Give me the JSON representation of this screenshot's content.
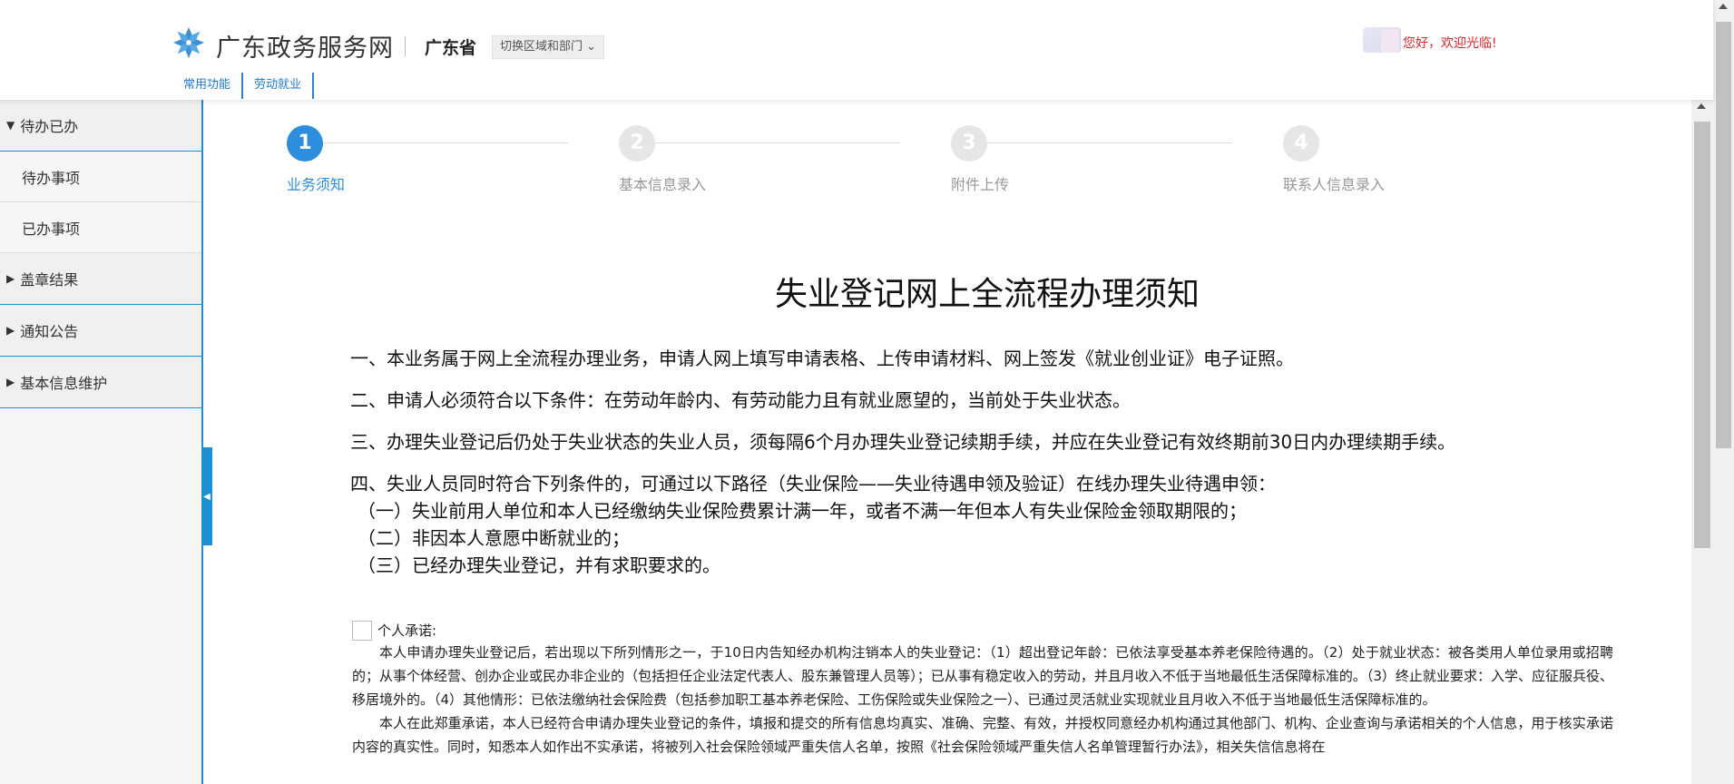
{
  "header": {
    "site_title": "广东政务服务网",
    "province": "广东省",
    "region_switch": "切换区域和部门 ⌄",
    "welcome": "您好，欢迎光临!",
    "nav_tabs": [
      "常用功能",
      "劳动就业"
    ]
  },
  "sidebar": {
    "groups": [
      {
        "label": "待办已办",
        "arrow": "▼",
        "items": [
          "待办事项",
          "已办事项"
        ]
      },
      {
        "label": "盖章结果",
        "arrow": "▶"
      },
      {
        "label": "通知公告",
        "arrow": "▶"
      },
      {
        "label": "基本信息维护",
        "arrow": "▶"
      }
    ]
  },
  "steps": [
    {
      "number": "1",
      "label": "业务须知",
      "active": true
    },
    {
      "number": "2",
      "label": "基本信息录入",
      "active": false
    },
    {
      "number": "3",
      "label": "附件上传",
      "active": false
    },
    {
      "number": "4",
      "label": "联系人信息录入",
      "active": false
    }
  ],
  "notice": {
    "title": "失业登记网上全流程办理须知",
    "paragraphs": [
      "一、本业务属于网上全流程办理业务，申请人网上填写申请表格、上传申请材料、网上签发《就业创业证》电子证照。",
      "二、申请人必须符合以下条件：在劳动年龄内、有劳动能力且有就业愿望的，当前处于失业状态。",
      "三、办理失业登记后仍处于失业状态的失业人员，须每隔6个月办理失业登记续期手续，并应在失业登记有效终期前30日内办理续期手续。",
      "四、失业人员同时符合下列条件的，可通过以下路径（失业保险——失业待遇申领及验证）在线办理失业待遇申领：",
      "（一）失业前用人单位和本人已经缴纳失业保险费累计满一年，或者不满一年但本人有失业保险金领取期限的；",
      "（二）非因本人意愿中断就业的；",
      "（三）已经办理失业登记，并有求职要求的。"
    ]
  },
  "commitment": {
    "label": "个人承诺:",
    "text1": "本人申请办理失业登记后，若出现以下所列情形之一，于10日内告知经办机构注销本人的失业登记：（1）超出登记年龄：已依法享受基本养老保险待遇的。（2）处于就业状态：被各类用人单位录用或招聘的；从事个体经营、创办企业或民办非企业的（包括担任企业法定代表人、股东兼管理人员等）；已从事有稳定收入的劳动，并且月收入不低于当地最低生活保障标准的。（3）终止就业要求：入学、应征服兵役、移居境外的。（4）其他情形：已依法缴纳社会保险费（包括参加职工基本养老保险、工伤保险或失业保险之一）、已通过灵活就业实现就业且月收入不低于当地最低生活保障标准的。",
    "text2": "本人在此郑重承诺，本人已经符合申请办理失业登记的条件，填报和提交的所有信息均真实、准确、完整、有效，并授权同意经办机构通过其他部门、机构、企业查询与承诺相关的个人信息，用于核实承诺内容的真实性。同时，知悉本人如作出不实承诺，将被列入社会保险领域严重失信人名单，按照《社会保险领域严重失信人名单管理暂行办法》，相关失信信息将在"
  },
  "colors": {
    "accent": "#2e8ede",
    "sidebar_border": "#1b8fd1",
    "welcome": "#e0252b"
  }
}
